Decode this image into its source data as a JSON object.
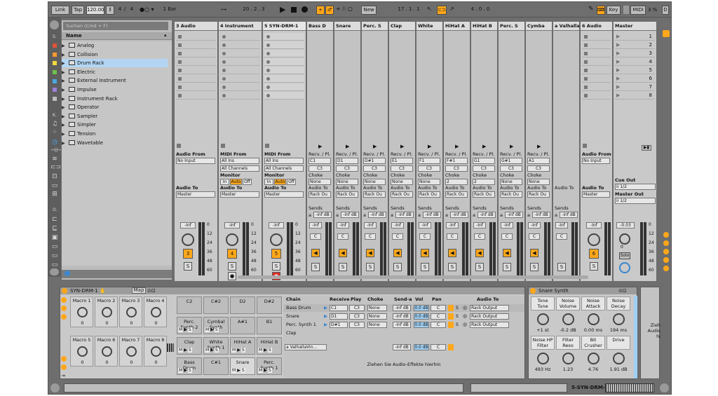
{
  "transport": {
    "link": "Link",
    "tap": "Tap",
    "tempo": "120.00",
    "sig_num": "4",
    "sig_den": "4",
    "metro": "1 Bar",
    "pos": "20 .  2 .  3",
    "new_label": "New",
    "loop_start": "17 .  1 .  1",
    "loop_len": "4 .  0 .  0",
    "key": "Key",
    "midi": "MIDI",
    "cpu": "3 %",
    "d": "D"
  },
  "browser": {
    "search_placeholder": "Suchen (Cmd + F)",
    "col_header": "Name",
    "side_s": "S.",
    "side_k": "K.",
    "side_o": "O.",
    "items": [
      {
        "label": "Analog"
      },
      {
        "label": "Collision"
      },
      {
        "label": "Drum Rack"
      },
      {
        "label": "Electric"
      },
      {
        "label": "External Instrument"
      },
      {
        "label": "Impulse"
      },
      {
        "label": "Instrument Rack"
      },
      {
        "label": "Operator"
      },
      {
        "label": "Sampler"
      },
      {
        "label": "Simpler"
      },
      {
        "label": "Tension"
      },
      {
        "label": "Wavetable"
      }
    ],
    "colors": [
      "#e0533a",
      "#ff9a2e",
      "#f2d940",
      "#6ec04e",
      "#4aa8e0",
      "#9f80d8",
      "#bdbdbd"
    ]
  },
  "tracks": [
    {
      "name": "3 Audio",
      "kind": "audio",
      "from_label": "Audio From",
      "from": "No Input",
      "to_label": "Audio To",
      "to": "Master",
      "vol": "-Inf",
      "num": "3"
    },
    {
      "name": "4 Instrument",
      "kind": "midi",
      "from_label": "MIDI From",
      "from": "All Ins",
      "chan": "All Channels",
      "monitor": "Monitor",
      "mon_in": "In",
      "mon_auto": "Auto",
      "mon_off": "Off",
      "to_label": "Audio To",
      "to": "Master",
      "vol": "-Inf",
      "num": "4"
    },
    {
      "name": "5 SYN-DRM-1",
      "kind": "midi",
      "from_label": "MIDI From",
      "from": "All Ins",
      "chan": "All Channels",
      "monitor": "Monitor",
      "mon_in": "In",
      "mon_auto": "Auto",
      "mon_off": "Off",
      "to_label": "Audio To",
      "to": "Master",
      "vol": "-Inf",
      "num": "5"
    },
    {
      "name": "Bass D",
      "kind": "chain",
      "recv": "Recv. / Pl.",
      "note": "C1",
      "play": "C3",
      "choke_label": "Choke",
      "choke": "None",
      "audio_to": "Audio To",
      "out": "Rack Ou",
      "sends": "Sends",
      "send_a": "a",
      "send_val": "-inf dB",
      "vol": "-Inf",
      "pan": "C"
    },
    {
      "name": "Snare",
      "kind": "chain",
      "recv": "Recv. / Pl.",
      "note": "D1",
      "play": "C3",
      "choke_label": "Choke",
      "choke": "None",
      "audio_to": "Audio To",
      "out": "Rack Ou",
      "sends": "Sends",
      "send_a": "a",
      "send_val": "-inf dB",
      "vol": "-Inf",
      "pan": "C"
    },
    {
      "name": "Perc. S",
      "kind": "chain",
      "recv": "Recv. / Pl.",
      "note": "D#1",
      "play": "C3",
      "choke_label": "Choke",
      "choke": "None",
      "audio_to": "Audio To",
      "out": "Rack Ou",
      "sends": "Sends",
      "send_a": "a",
      "send_val": "-inf dB",
      "vol": "-Inf",
      "pan": "C"
    },
    {
      "name": "Clap",
      "kind": "chain",
      "recv": "Recv. / Pl.",
      "note": "E1",
      "play": "C3",
      "choke_label": "Choke",
      "choke": "None",
      "audio_to": "Audio To",
      "out": "Rack Ou",
      "sends": "Sends",
      "send_a": "a",
      "send_val": "-inf dB",
      "vol": "-Inf",
      "pan": "C"
    },
    {
      "name": "White",
      "kind": "chain",
      "recv": "Recv. / Pl.",
      "note": "F1",
      "play": "C3",
      "choke_label": "Choke",
      "choke": "None",
      "audio_to": "Audio To",
      "out": "Rack Ou",
      "sends": "Sends",
      "send_a": "a",
      "send_val": "-inf dB",
      "vol": "-Inf",
      "pan": "C"
    },
    {
      "name": "HiHat A",
      "kind": "chain",
      "recv": "Recv. / Pl.",
      "note": "F#1",
      "play": "C3",
      "choke_label": "Choke",
      "choke": "2",
      "audio_to": "Audio To",
      "out": "Rack Ou",
      "sends": "Sends",
      "send_a": "a",
      "send_val": "-inf dB",
      "vol": "-Inf",
      "pan": "C"
    },
    {
      "name": "HiHat B",
      "kind": "chain",
      "recv": "Recv. / Pl.",
      "note": "G1",
      "play": "C3",
      "choke_label": "Choke",
      "choke": "2",
      "audio_to": "Audio To",
      "out": "Rack Ou",
      "sends": "Sends",
      "send_a": "a",
      "send_val": "-inf dB",
      "vol": "-Inf",
      "pan": "C"
    },
    {
      "name": "Perc. S",
      "kind": "chain",
      "recv": "Recv. / Pl.",
      "note": "G#1",
      "play": "C3",
      "choke_label": "Choke",
      "choke": "None",
      "audio_to": "Audio To",
      "out": "Rack Ou",
      "sends": "Sends",
      "send_a": "a",
      "send_val": "-inf dB",
      "vol": "-Inf",
      "pan": "C"
    },
    {
      "name": "Cymba",
      "kind": "chain",
      "recv": "Recv. / Pl.",
      "note": "A1",
      "play": "C3",
      "choke_label": "Choke",
      "choke": "None",
      "audio_to": "Audio To",
      "out": "Rack Ou",
      "sends": "Sends",
      "send_a": "a",
      "send_val": "-inf dB",
      "vol": "-Inf",
      "pan": "C"
    },
    {
      "name": "a Valhalla",
      "kind": "return",
      "audio_to": "Audio To",
      "sends": "Sends",
      "send_a": "a",
      "send_val": "-inf dB",
      "vol": "-Inf",
      "pan": "C"
    },
    {
      "name": "6 Audio",
      "kind": "audio",
      "from_label": "Audio From",
      "from": "No Input",
      "to_label": "Audio To",
      "to": "Master",
      "vol": "-Inf",
      "num": "6"
    }
  ],
  "master": {
    "name": "Master",
    "scenes": [
      "1",
      "2",
      "3",
      "4",
      "5",
      "6",
      "7",
      "8"
    ],
    "cue_out": "Cue Out",
    "cue_val": "ii 1/2",
    "master_out": "Master Out",
    "master_val": "ii 1/2",
    "vol": "-0.03",
    "pan": "0",
    "solo": "Solo"
  },
  "meter_scale": [
    "0",
    "12",
    "24",
    "36",
    "48",
    "60"
  ],
  "mixer_btn_s": "S",
  "drumrack": {
    "title": "SYN-DRM-1",
    "map": "Map",
    "macros_top": [
      "Macro 1",
      "Macro 2",
      "Macro 3",
      "Macro 4"
    ],
    "macros_bottom": [
      "Macro 5",
      "Macro 6",
      "Macro 7",
      "Macro 8"
    ],
    "macro_val": "0",
    "pads": [
      {
        "label": "C2"
      },
      {
        "label": "C#2"
      },
      {
        "label": "D2"
      },
      {
        "label": "D#2"
      },
      {
        "label": "Perc. Synth 2"
      },
      {
        "label": "Cymbal Synth"
      },
      {
        "label": "A#1"
      },
      {
        "label": "B1"
      },
      {
        "label": "Clap"
      },
      {
        "label": "White Synth 1"
      },
      {
        "label": "HiHat A"
      },
      {
        "label": "HiHat B"
      },
      {
        "label": "Bass Drum"
      },
      {
        "label": "C#1"
      },
      {
        "label": "Snare"
      },
      {
        "label": "Perc. Synth 1"
      }
    ],
    "pad_m": "M",
    "pad_s": "S",
    "chain_header": {
      "chain": "Chain",
      "receive": "Receive",
      "play": "Play",
      "choke": "Choke",
      "send_a": "Send-a",
      "vol": "Vol",
      "pan": "Pan",
      "audio_to": "Audio To"
    },
    "chains": [
      {
        "name": "Bass Drum",
        "recv": "C1",
        "play": "C3",
        "choke": "None",
        "send": "-inf dB",
        "vol": "0.0 dB",
        "pan": "C",
        "out": "Rack Output"
      },
      {
        "name": "Snare",
        "recv": "D1",
        "play": "C3",
        "choke": "None",
        "send": "-inf dB",
        "vol": "0.0 dB",
        "pan": "C",
        "out": "Rack Output"
      },
      {
        "name": "Perc. Synth 1",
        "recv": "D#1",
        "play": "C3",
        "choke": "None",
        "send": "-inf dB",
        "vol": "0.0 dB",
        "pan": "C",
        "out": "Rack Output"
      },
      {
        "name": "Clap",
        "recv": "",
        "play": "",
        "choke": "",
        "send": "",
        "vol": "",
        "pan": "",
        "out": ""
      }
    ],
    "return_chain": {
      "name": "a ValhallaVin...",
      "send": "-inf dB",
      "vol": "0.0 dB",
      "pan": "C"
    },
    "drop_hint": "Ziehen Sie Audio-Effekte hierhin"
  },
  "synth": {
    "title": "Snare Synth",
    "top": [
      {
        "label": "Tone Tune",
        "val": "+1 st"
      },
      {
        "label": "Noise Volume",
        "val": "-0.2 dB"
      },
      {
        "label": "Noise Attack",
        "val": "0.00 ms"
      },
      {
        "label": "Noise Decay",
        "val": "194 ms"
      }
    ],
    "bottom": [
      {
        "label": "Noise HP Filter",
        "val": "493 Hz"
      },
      {
        "label": "Filter Reso",
        "val": "1.23"
      },
      {
        "label": "Bit Crusher",
        "val": "4.76"
      },
      {
        "label": "Drive",
        "val": "1.91 dB"
      }
    ],
    "side_hint": "Zieh Audio hi"
  },
  "statusbar": {
    "track": "5-SYN-DRM-1"
  }
}
